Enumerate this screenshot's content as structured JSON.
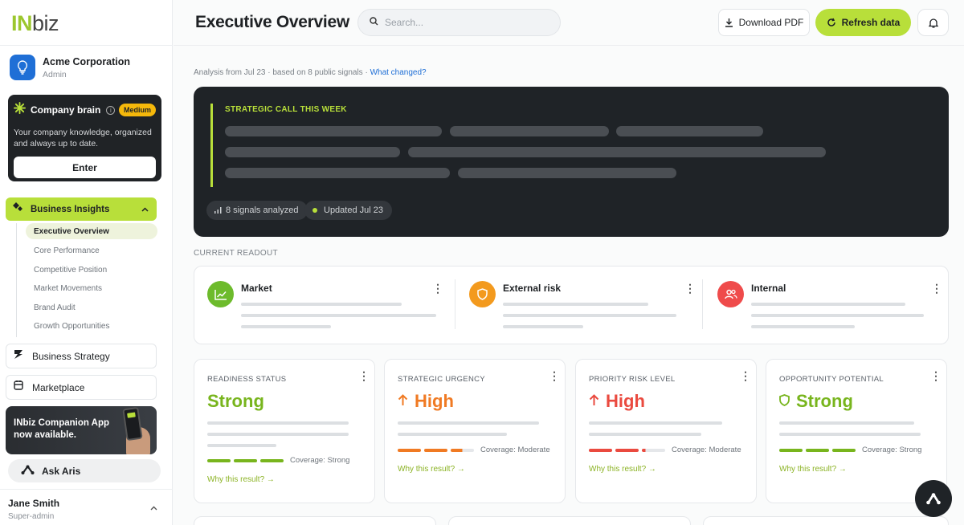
{
  "brand": {
    "logo_in": "IN",
    "logo_biz": "biz"
  },
  "org": {
    "name": "Acme Corporation",
    "role": "Admin"
  },
  "company_brain": {
    "title": "Company brain",
    "badge": "Medium",
    "description": "Your company knowledge, organized and always up to date.",
    "enter_label": "Enter"
  },
  "sidebar": {
    "active_section": "Business Insights",
    "subitems": [
      "Executive Overview",
      "Core Performance",
      "Competitive Position",
      "Market Movements",
      "Brand Audit",
      "Growth Opportunities"
    ],
    "business_strategy": "Business Strategy",
    "marketplace": "Marketplace",
    "promo": "INbiz Companion App now available.",
    "ask_aris": "Ask Aris"
  },
  "user": {
    "name": "Jane Smith",
    "role": "Super-admin"
  },
  "header": {
    "title": "Executive Overview",
    "search_placeholder": "Search...",
    "download_label": "Download PDF",
    "refresh_label": "Refresh data"
  },
  "analysis": {
    "text": "Analysis from Jul 23 · based on 8 public signals · ",
    "link": "What changed?"
  },
  "strategic": {
    "label": "STRATEGIC CALL THIS WEEK",
    "signals": "8 signals analyzed",
    "updated": "Updated Jul 23"
  },
  "readout": {
    "section_label": "CURRENT READOUT",
    "items": [
      {
        "title": "Market",
        "icon": "trend-up-icon",
        "color": "#6dbb2c"
      },
      {
        "title": "External risk",
        "icon": "shield-icon",
        "color": "#f39a1e"
      },
      {
        "title": "Internal",
        "icon": "people-icon",
        "color": "#ef4b4b"
      }
    ]
  },
  "metrics": [
    {
      "label": "READINESS STATUS",
      "value": "Strong",
      "coverage": "Coverage: Strong",
      "coverage_level": 1.0,
      "why": "Why this result? →",
      "color": "#78b51d"
    },
    {
      "label": "STRATEGIC URGENCY",
      "value": "High",
      "coverage": "Coverage: Moderate",
      "coverage_level": 0.83,
      "why": "Why this result? →",
      "color": "#f07a23"
    },
    {
      "label": "PRIORITY RISK LEVEL",
      "value": "High",
      "coverage": "Coverage: Moderate",
      "coverage_level": 0.83,
      "why": "Why this result? →",
      "color": "#ea4a3f"
    },
    {
      "label": "OPPORTUNITY POTENTIAL",
      "value": "Strong",
      "coverage": "Coverage: Strong",
      "coverage_level": 1.0,
      "why": "Why this result? →",
      "color": "#78b51d"
    }
  ]
}
